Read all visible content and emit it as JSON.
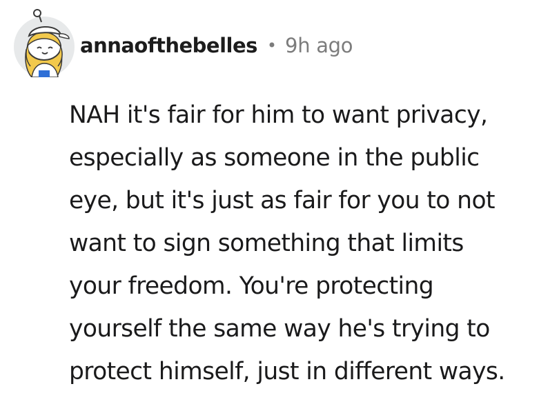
{
  "comment": {
    "author": "annaofthebelles",
    "separator": "•",
    "time": "9h ago",
    "avatar_icon": "snoo-avatar-icon",
    "text_lines": [
      "NAH it's fair for him to want privacy,",
      "especially as someone in the public",
      "eye, but it's just as fair for you to not",
      "want to sign something that limits",
      "your freedom. You're protecting",
      "yourself the same way he's trying to",
      "protect himself, just in different ways."
    ]
  }
}
